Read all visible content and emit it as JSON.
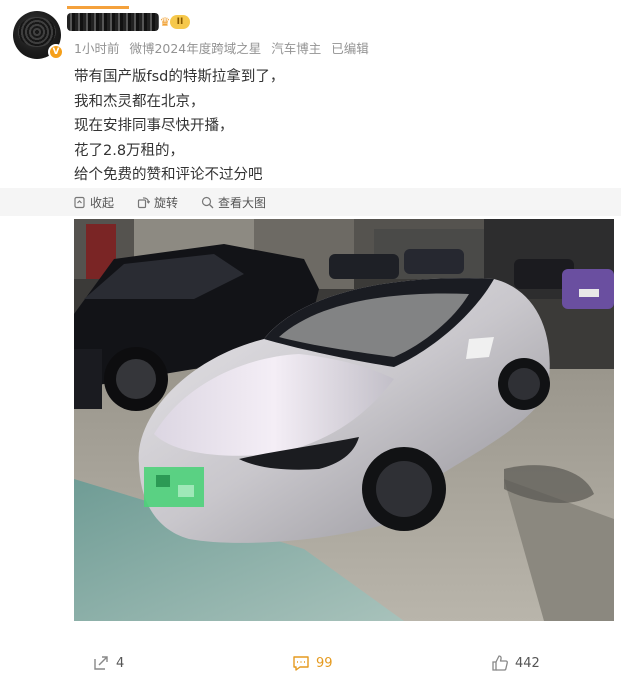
{
  "post": {
    "meta": {
      "time": "1小时前",
      "badge": "微博2024年度跨域之星",
      "role": "汽车博主",
      "edited": "已编辑"
    },
    "level": "II",
    "verify_mark": "V",
    "text_lines": [
      "带有国产版fsd的特斯拉拿到了，",
      "我和杰灵都在北京，",
      "现在安排同事尽快开播，",
      "花了2.8万租的，",
      "给个免费的赞和评论不过分吧"
    ]
  },
  "image_toolbar": {
    "collapse": "收起",
    "rotate": "旋转",
    "view_large": "查看大图"
  },
  "actions": {
    "reposts": "4",
    "comments": "99",
    "likes": "442"
  },
  "colors": {
    "accent_orange": "#f59f1a",
    "comment_count": "#e59a1f",
    "meta_gray": "#939393",
    "toolbar_bg": "#f5f5f5"
  }
}
